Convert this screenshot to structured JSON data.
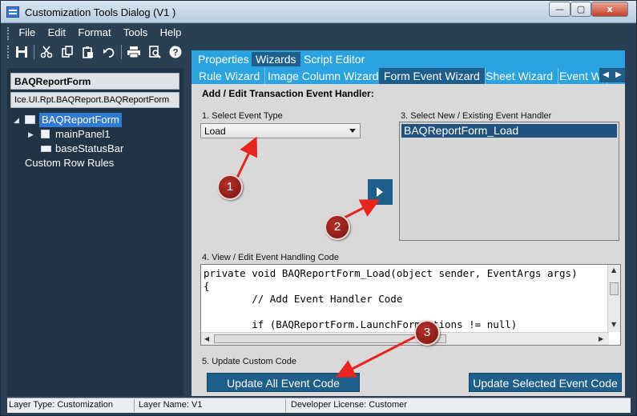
{
  "window": {
    "title": "Customization Tools Dialog  (V1 )",
    "buttons": {
      "minimize": "—",
      "maximize": "▢",
      "close": "x"
    }
  },
  "menu": {
    "items": [
      "File",
      "Edit",
      "Format",
      "Tools",
      "Help"
    ]
  },
  "toolbar": {
    "icons": [
      "save-icon",
      "cut-icon",
      "copy-icon",
      "paste-icon",
      "undo-icon",
      "print-icon",
      "print-preview-icon",
      "help-icon"
    ]
  },
  "left_pane": {
    "form_name": "BAQReportForm",
    "form_path": "Ice.UI.Rpt.BAQReport.BAQReportForm",
    "tree": [
      {
        "label": "BAQReportForm",
        "expander": "◢",
        "icon": "form-icon",
        "selected": true
      },
      {
        "label": "mainPanel1",
        "expander": "▶",
        "icon": "panel-icon",
        "selected": false
      },
      {
        "label": "baseStatusBar",
        "expander": "",
        "icon": "statusbar-icon",
        "selected": false
      },
      {
        "label": "Custom Row Rules",
        "expander": "",
        "icon": "",
        "selected": false
      }
    ]
  },
  "tabs_top": [
    {
      "label": "Properties",
      "active": false
    },
    {
      "label": "Wizards",
      "active": true
    },
    {
      "label": "Script Editor",
      "active": false
    }
  ],
  "tabs_wizards": [
    {
      "label": "Rule Wizard",
      "active": false
    },
    {
      "label": "Image Column Wizard",
      "active": false
    },
    {
      "label": "Form Event Wizard",
      "active": true
    },
    {
      "label": "Sheet Wizard",
      "active": false
    },
    {
      "label": "Event W",
      "active": false
    }
  ],
  "tab_scroll": {
    "left": "◀",
    "right": "▶"
  },
  "wizard": {
    "title": "Add / Edit Transaction Event Handler:",
    "step1_label": "1. Select Event Type",
    "event_type_value": "Load",
    "step3_label": "3. Select New / Existing Event Handler",
    "handlers": [
      "BAQReportForm_Load"
    ],
    "step4_label": "4. View / Edit Event Handling Code",
    "code_lines": [
      "private void BAQReportForm_Load(object sender, EventArgs args)",
      "{",
      "        // Add Event Handler Code",
      "",
      "        if (BAQReportForm.LaunchFormOptions != null)"
    ],
    "step5_label": "5. Update Custom Code",
    "update_all_label": "Update All Event Code",
    "update_selected_label": "Update Selected Event Code"
  },
  "status_bar": {
    "layer_type": "Layer Type:  Customization",
    "layer_name": "Layer Name:  V1",
    "developer_license": "Developer License:  Customer"
  },
  "annotations": {
    "badges": [
      "1",
      "2",
      "3"
    ],
    "arrow_color": "#e8241c"
  }
}
